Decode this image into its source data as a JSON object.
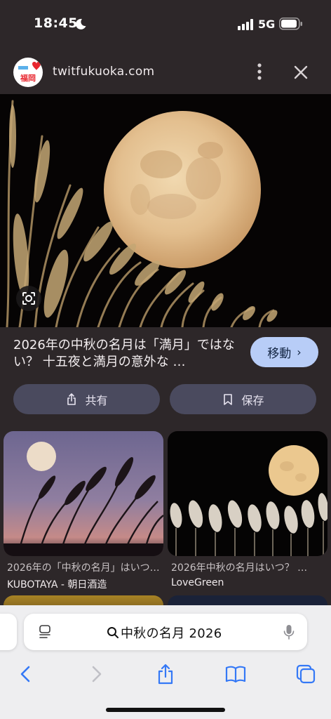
{
  "status_bar": {
    "time": "18:45",
    "network": "5G"
  },
  "header": {
    "logo_text": "福岡",
    "domain": "twitfukuoka.com",
    "more_icon": "more-vertical-icon",
    "close_icon": "close-icon"
  },
  "hero": {
    "lens_icon": "visual-search-icon"
  },
  "result": {
    "title": "2026年の中秋の名月は「満月」ではない？ 十五夜と満月の意外な …",
    "visit_label": "移動"
  },
  "actions": {
    "share_label": "共有",
    "save_label": "保存"
  },
  "related": [
    {
      "title": "2026年の「中秋の名月」はいつ？ …",
      "source": "KUBOTAYA - 朝日酒造"
    },
    {
      "title": "2026年中秋の名月はいつ？ …",
      "source": "LoveGreen"
    }
  ],
  "address_bar": {
    "query": "中秋の名月 2026"
  },
  "toolbar": {
    "items": [
      "back-icon",
      "forward-icon",
      "share-icon",
      "bookmarks-icon",
      "tabs-icon"
    ]
  },
  "colors": {
    "background": "#2d2729",
    "visit_button": "#b8cdf7",
    "pill_button": "#4a4a5e",
    "toolbar_accent": "#3478f6"
  }
}
